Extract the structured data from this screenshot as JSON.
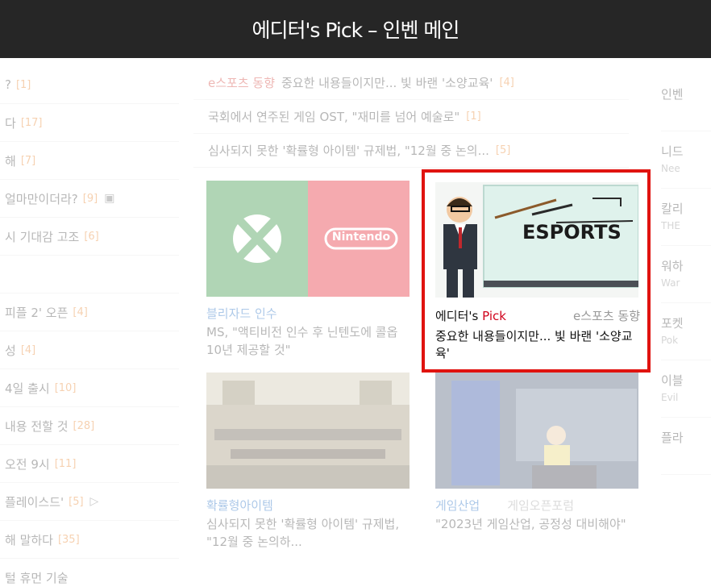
{
  "header": {
    "title": "에디터's Pick – 인벤 메인"
  },
  "left_list": [
    {
      "text": "?",
      "count": "[1]"
    },
    {
      "text": "다",
      "count": "[17]"
    },
    {
      "text": "해",
      "count": "[7]"
    },
    {
      "text": "얼마만이더라?",
      "count": "[9]",
      "icon": "photo-icon"
    },
    {
      "text": "시 기대감 고조",
      "count": "[6]"
    },
    {
      "text": "",
      "count": ""
    },
    {
      "text": "피플 2' 오픈",
      "count": "[4]"
    },
    {
      "text": "성",
      "count": "[4]"
    },
    {
      "text": "4일 출시",
      "count": "[10]"
    },
    {
      "text": "내용 전할 것",
      "count": "[28]"
    },
    {
      "text": "오전 9시",
      "count": "[11]"
    },
    {
      "text": "플레이스드'",
      "count": "[5]",
      "icon": "play-icon"
    },
    {
      "text": "해 말하다",
      "count": "[35]"
    },
    {
      "text": "털 휴먼 기술",
      "count": ""
    }
  ],
  "mid_list": [
    {
      "category": "e스포츠 동향",
      "text": "중요한 내용들이지만... 빛 바랜 '소양교육'",
      "count": "[4]"
    },
    {
      "category": "",
      "text": "국회에서 연주된 게임 OST, \"재미를 넘어 예술로\"",
      "count": "[1]"
    },
    {
      "category": "",
      "text": "심사되지 못한 '확률형 아이템' 규제법, \"12월 중 논의...",
      "count": "[5]"
    }
  ],
  "cards": [
    {
      "category": "블리자드 인수",
      "title": "MS, \"액티비전 인수 후 닌텐도에 콜옵 10년 제공할 것\"",
      "thumb_logo": "Nintendo"
    },
    {
      "category": "확률형아이템",
      "title": "심사되지 못한 '확률형 아이템' 규제법, \"12월 중 논의하..."
    },
    {
      "category": "게임산업",
      "category2": "게임오픈포럼",
      "title": "\"2023년 게임산업, 공정성 대비해야\""
    }
  ],
  "highlight": {
    "thumb_text": "ESPORTS",
    "editor": "에디터's ",
    "pick": "Pick",
    "category": "e스포츠 동향",
    "title": "중요한 내용들이지만... 빛 바랜 '소양교육'"
  },
  "right_list": [
    {
      "text": "인벤",
      "sub": ""
    },
    {
      "text": "니드",
      "sub": "Nee"
    },
    {
      "text": "칼리",
      "sub": "THE"
    },
    {
      "text": "워하",
      "sub": "War"
    },
    {
      "text": "포켓",
      "sub": "Pok"
    },
    {
      "text": "이블",
      "sub": "Evil"
    },
    {
      "text": "플라",
      "sub": ""
    }
  ],
  "colors": {
    "header_bg": "#262626",
    "highlight_border": "#e0130f",
    "pick_red": "#d0021b",
    "count_orange": "#e67e22"
  }
}
